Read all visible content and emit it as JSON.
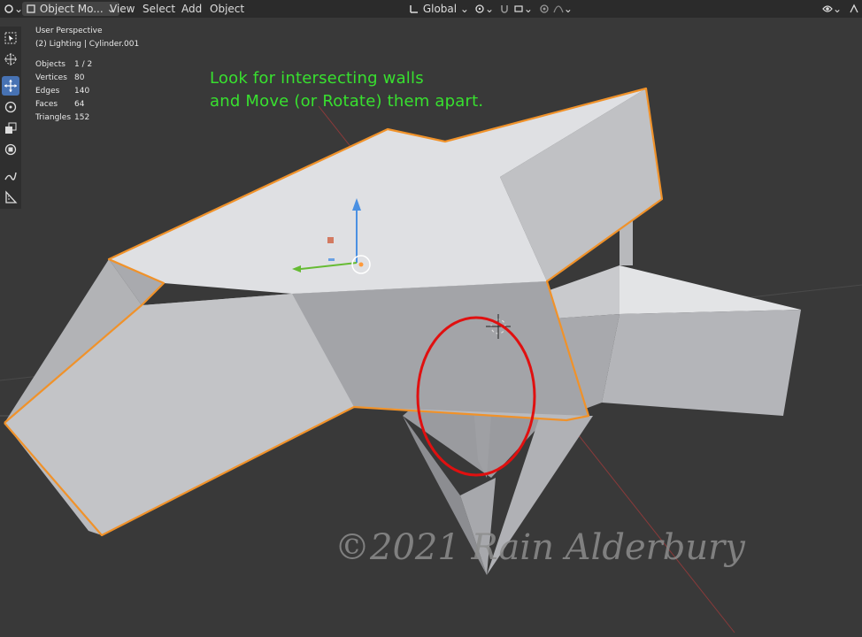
{
  "header": {
    "mode_label": "Object Mo...",
    "menu": [
      "View",
      "Select",
      "Add",
      "Object"
    ],
    "orientation_label": "Global"
  },
  "overlay": {
    "view_name": "User Perspective",
    "collection": "(2) Lighting | Cylinder.001",
    "stats": [
      {
        "label": "Objects",
        "value": "1 / 2"
      },
      {
        "label": "Vertices",
        "value": "80"
      },
      {
        "label": "Edges",
        "value": "140"
      },
      {
        "label": "Faces",
        "value": "64"
      },
      {
        "label": "Triangles",
        "value": "152"
      }
    ]
  },
  "instruction": {
    "line1": "Look for intersecting walls",
    "line2": "and Move (or Rotate) them apart."
  },
  "watermark": "©2021 Rain Alderbury",
  "colors": {
    "selection_outline": "#f0922a",
    "annotation_circle": "#e01010",
    "instruction_text": "#38e02f",
    "active_tool": "#4772b3"
  },
  "tools": [
    "select-box-icon",
    "cursor-icon",
    "move-icon",
    "rotate-icon",
    "scale-icon",
    "transform-icon",
    "annotate-icon",
    "measure-icon"
  ]
}
